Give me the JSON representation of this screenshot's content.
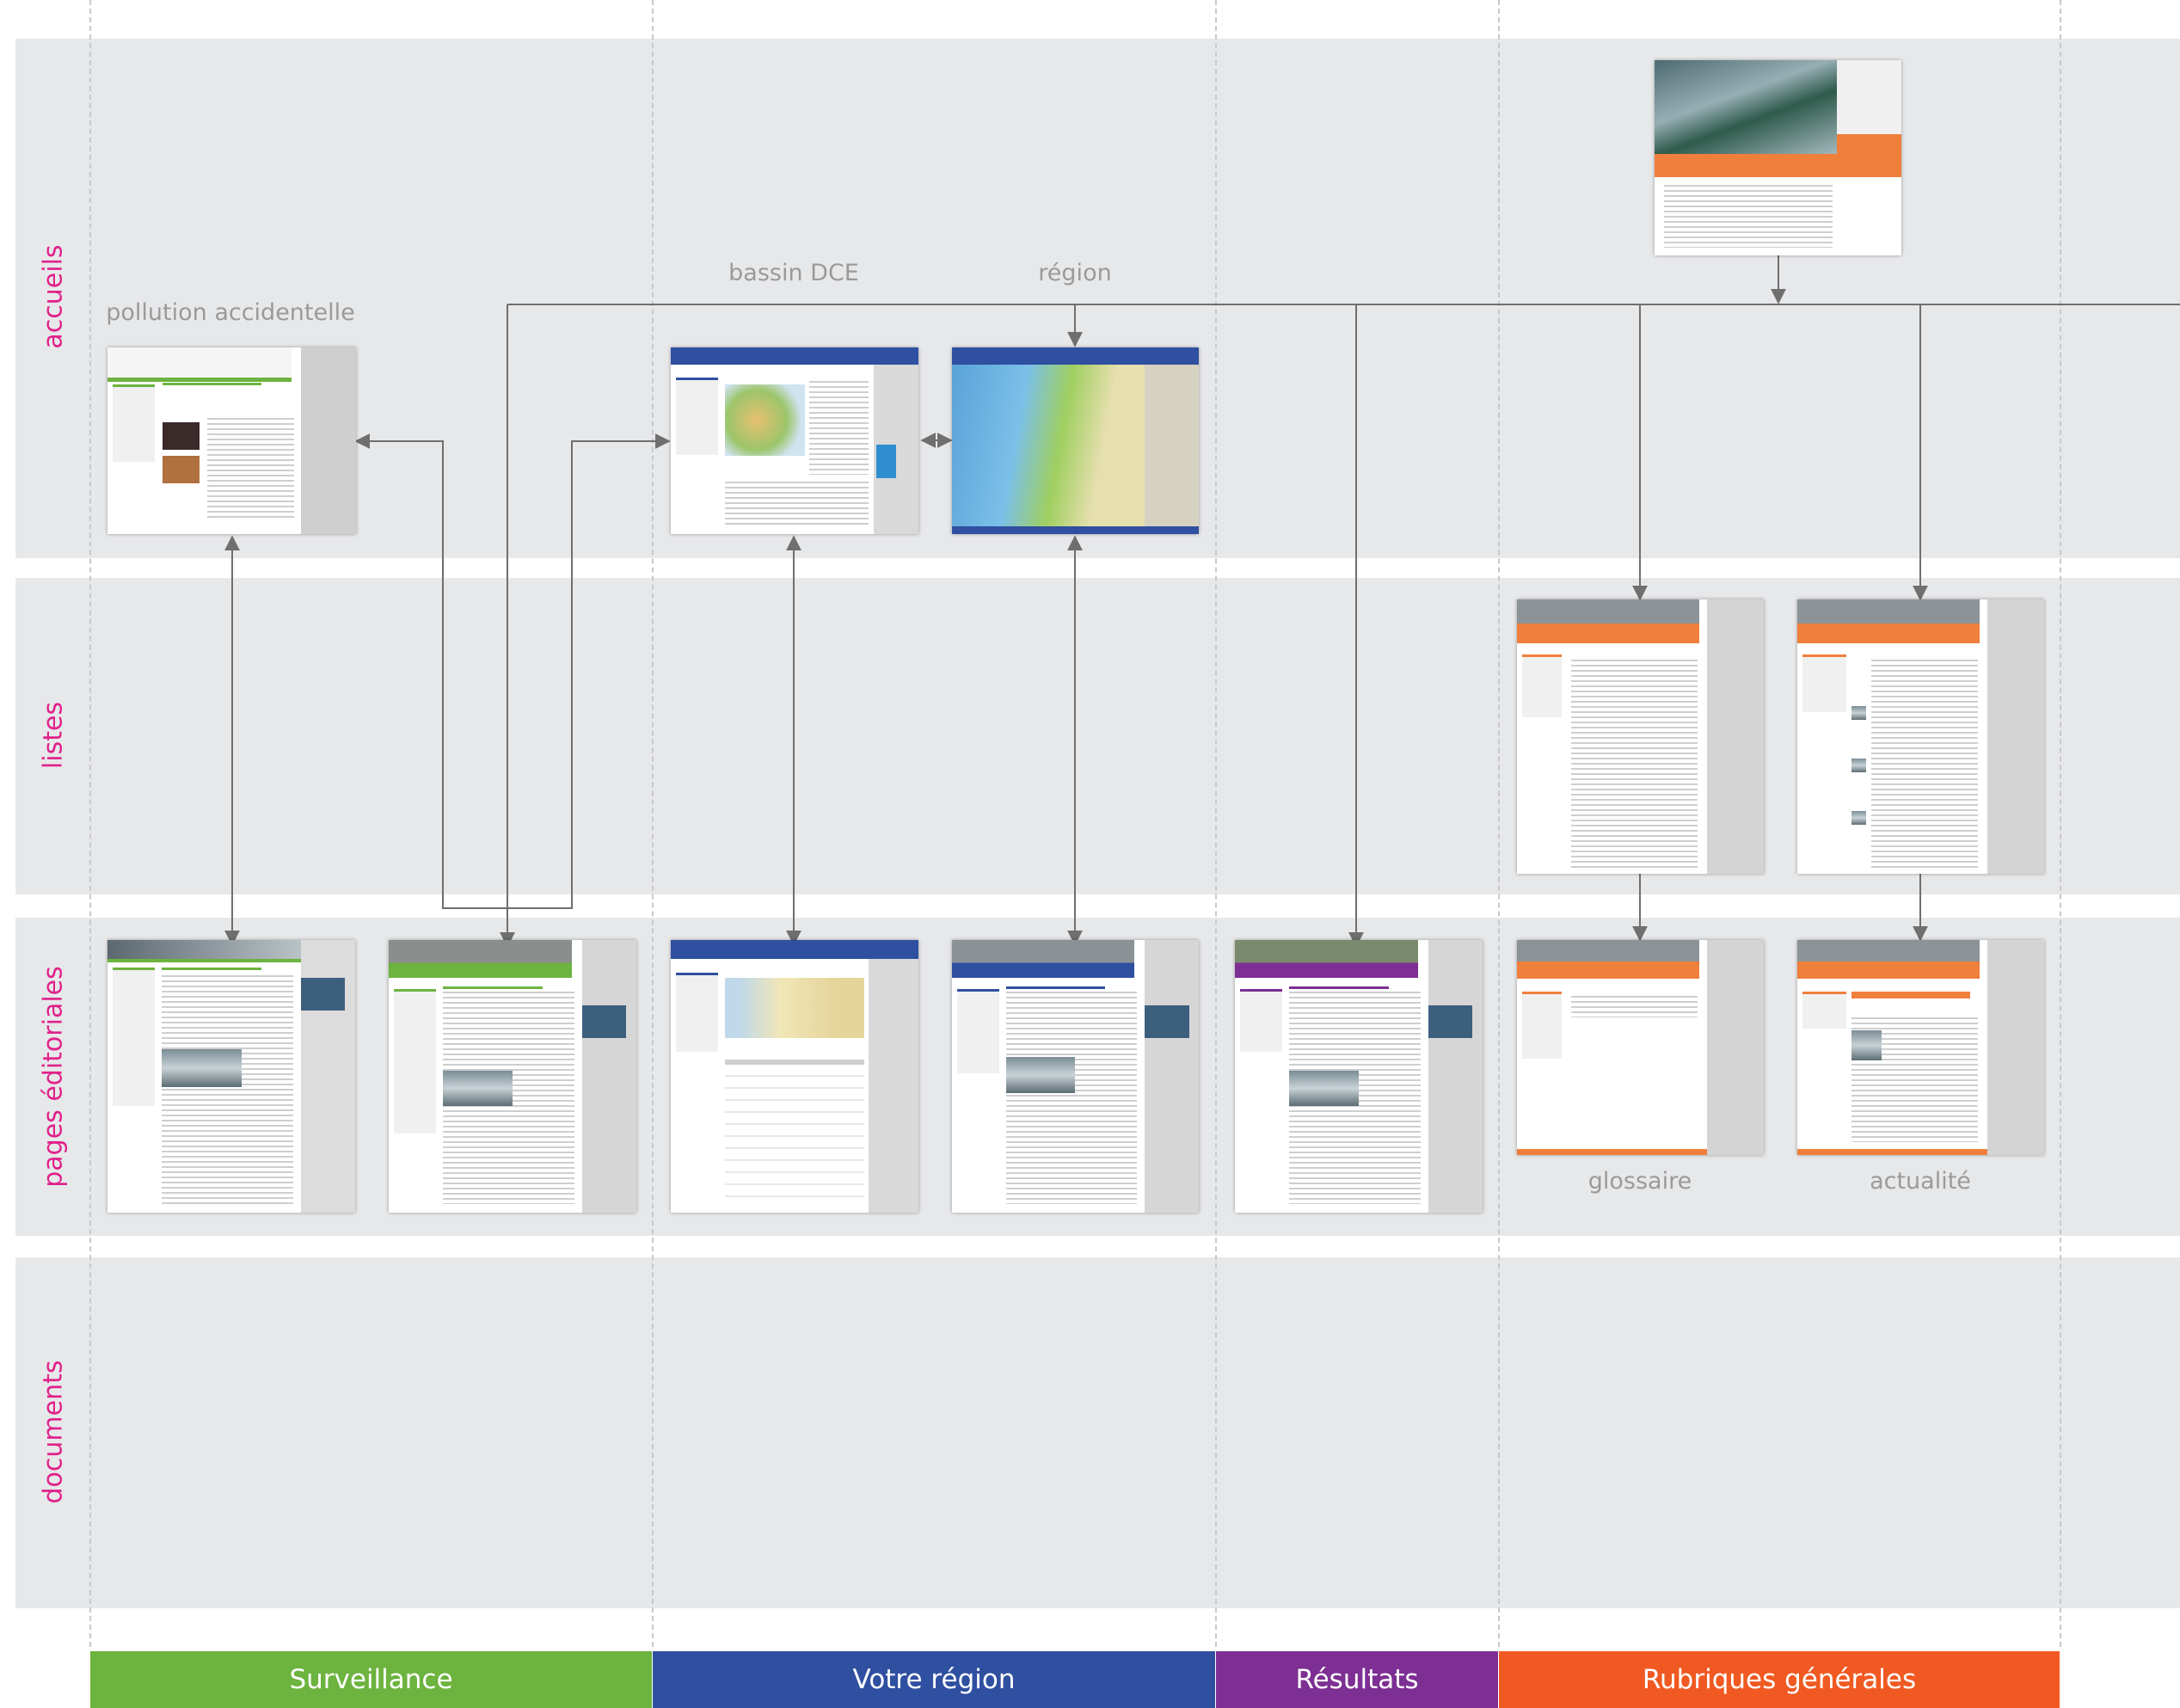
{
  "rows": [
    {
      "id": "accueils",
      "label": "accueils"
    },
    {
      "id": "listes",
      "label": "listes"
    },
    {
      "id": "pages",
      "label": "pages éditoriales"
    },
    {
      "id": "documents",
      "label": "documents"
    }
  ],
  "sections": [
    {
      "label": "Surveillance",
      "color": "#6db33f"
    },
    {
      "label": "Votre région",
      "color": "#2f4fa0"
    },
    {
      "label": "Résultats",
      "color": "#7d2f93"
    },
    {
      "label": "Rubriques générales",
      "color": "#f05a22"
    }
  ],
  "captions": {
    "pollution": "pollution accidentelle",
    "bassin": "bassin DCE",
    "region": "région",
    "glossaire": "glossaire",
    "actualite": "actualité"
  },
  "colors": {
    "band": "#e7e8ea",
    "row_label": "#e0218a",
    "caption": "#9a9a9a",
    "connector": "#6f6f6f"
  },
  "thumbnails": [
    {
      "name": "home-page-thumb",
      "theme": "orange"
    },
    {
      "name": "pollution-accidentelle-thumb",
      "theme": "green"
    },
    {
      "name": "bassin-dce-thumb",
      "theme": "blue"
    },
    {
      "name": "region-thumb",
      "theme": "blue-map"
    },
    {
      "name": "glossaire-list-thumb",
      "theme": "orange"
    },
    {
      "name": "actualite-list-thumb",
      "theme": "orange"
    },
    {
      "name": "surveillance-page-1-thumb",
      "theme": "green"
    },
    {
      "name": "surveillance-page-2-thumb",
      "theme": "green"
    },
    {
      "name": "region-page-1-thumb",
      "theme": "blue"
    },
    {
      "name": "region-page-2-thumb",
      "theme": "blue"
    },
    {
      "name": "resultats-page-thumb",
      "theme": "purple"
    },
    {
      "name": "glossaire-page-thumb",
      "theme": "orange"
    },
    {
      "name": "actualite-page-thumb",
      "theme": "orange"
    }
  ]
}
